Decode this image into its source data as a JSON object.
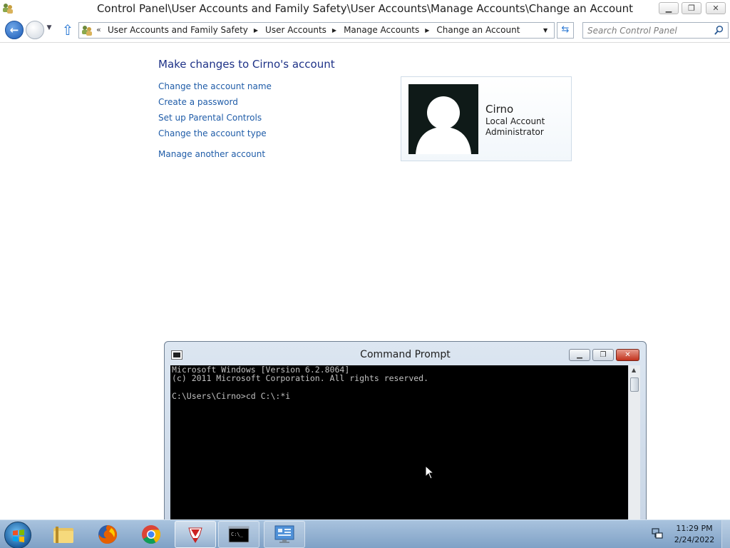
{
  "window": {
    "title": "Control Panel\\User Accounts and Family Safety\\User Accounts\\Manage Accounts\\Change an Account",
    "controls": {
      "minimize": "▁",
      "maximize": "❐",
      "close": "✕"
    }
  },
  "nav": {
    "back_icon": "back-arrow-icon",
    "forward_icon": "forward-arrow-icon",
    "up_icon": "up-arrow-icon",
    "address_prefix": "«",
    "breadcrumbs": [
      "User Accounts and Family Safety",
      "User Accounts",
      "Manage Accounts",
      "Change an Account"
    ],
    "search_placeholder": "Search Control Panel"
  },
  "content": {
    "heading": "Make changes to Cirno's account",
    "links": [
      "Change the account name",
      "Create a password",
      "Set up Parental Controls",
      "Change the account type",
      "Manage another account"
    ],
    "account": {
      "name": "Cirno",
      "type": "Local Account",
      "role": "Administrator"
    }
  },
  "cmd": {
    "title": "Command Prompt",
    "lines": [
      "Microsoft Windows [Version 6.2.8064]",
      "(c) 2011 Microsoft Corporation. All rights reserved.",
      "",
      "C:\\Users\\Cirno>cd C:\\:*i"
    ],
    "controls": {
      "minimize": "▁",
      "maximize": "❐",
      "close": "✕"
    }
  },
  "taskbar": {
    "start_icon": "windows-start-icon",
    "items": [
      {
        "name": "file-explorer",
        "icon": "folder-icon"
      },
      {
        "name": "firefox",
        "icon": "firefox-icon"
      },
      {
        "name": "chrome",
        "icon": "chrome-icon"
      },
      {
        "name": "app-red",
        "icon": "red-white-app-icon"
      },
      {
        "name": "command-prompt",
        "icon": "cmd-icon"
      },
      {
        "name": "control-panel",
        "icon": "control-panel-icon"
      }
    ],
    "clock": {
      "time": "11:29 PM",
      "date": "2/24/2022"
    }
  },
  "colors": {
    "link": "#1f5ca8",
    "heading": "#1e3287",
    "console_bg": "#000000",
    "console_text": "#c0c0c0",
    "taskbar": "#8fb0d2"
  }
}
